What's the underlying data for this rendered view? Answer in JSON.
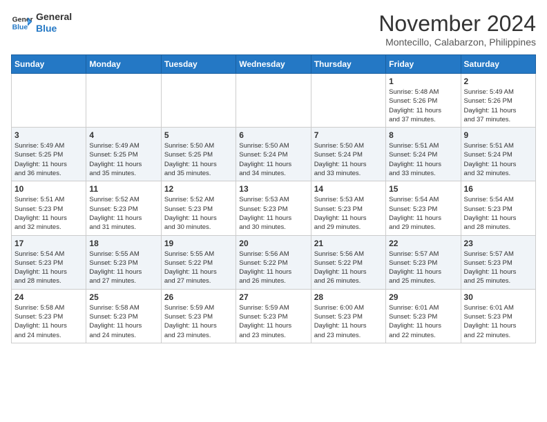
{
  "header": {
    "logo_line1": "General",
    "logo_line2": "Blue",
    "month_title": "November 2024",
    "location": "Montecillo, Calabarzon, Philippines"
  },
  "weekdays": [
    "Sunday",
    "Monday",
    "Tuesday",
    "Wednesday",
    "Thursday",
    "Friday",
    "Saturday"
  ],
  "weeks": [
    [
      {
        "day": "",
        "info": ""
      },
      {
        "day": "",
        "info": ""
      },
      {
        "day": "",
        "info": ""
      },
      {
        "day": "",
        "info": ""
      },
      {
        "day": "",
        "info": ""
      },
      {
        "day": "1",
        "info": "Sunrise: 5:48 AM\nSunset: 5:26 PM\nDaylight: 11 hours\nand 37 minutes."
      },
      {
        "day": "2",
        "info": "Sunrise: 5:49 AM\nSunset: 5:26 PM\nDaylight: 11 hours\nand 37 minutes."
      }
    ],
    [
      {
        "day": "3",
        "info": "Sunrise: 5:49 AM\nSunset: 5:25 PM\nDaylight: 11 hours\nand 36 minutes."
      },
      {
        "day": "4",
        "info": "Sunrise: 5:49 AM\nSunset: 5:25 PM\nDaylight: 11 hours\nand 35 minutes."
      },
      {
        "day": "5",
        "info": "Sunrise: 5:50 AM\nSunset: 5:25 PM\nDaylight: 11 hours\nand 35 minutes."
      },
      {
        "day": "6",
        "info": "Sunrise: 5:50 AM\nSunset: 5:24 PM\nDaylight: 11 hours\nand 34 minutes."
      },
      {
        "day": "7",
        "info": "Sunrise: 5:50 AM\nSunset: 5:24 PM\nDaylight: 11 hours\nand 33 minutes."
      },
      {
        "day": "8",
        "info": "Sunrise: 5:51 AM\nSunset: 5:24 PM\nDaylight: 11 hours\nand 33 minutes."
      },
      {
        "day": "9",
        "info": "Sunrise: 5:51 AM\nSunset: 5:24 PM\nDaylight: 11 hours\nand 32 minutes."
      }
    ],
    [
      {
        "day": "10",
        "info": "Sunrise: 5:51 AM\nSunset: 5:23 PM\nDaylight: 11 hours\nand 32 minutes."
      },
      {
        "day": "11",
        "info": "Sunrise: 5:52 AM\nSunset: 5:23 PM\nDaylight: 11 hours\nand 31 minutes."
      },
      {
        "day": "12",
        "info": "Sunrise: 5:52 AM\nSunset: 5:23 PM\nDaylight: 11 hours\nand 30 minutes."
      },
      {
        "day": "13",
        "info": "Sunrise: 5:53 AM\nSunset: 5:23 PM\nDaylight: 11 hours\nand 30 minutes."
      },
      {
        "day": "14",
        "info": "Sunrise: 5:53 AM\nSunset: 5:23 PM\nDaylight: 11 hours\nand 29 minutes."
      },
      {
        "day": "15",
        "info": "Sunrise: 5:54 AM\nSunset: 5:23 PM\nDaylight: 11 hours\nand 29 minutes."
      },
      {
        "day": "16",
        "info": "Sunrise: 5:54 AM\nSunset: 5:23 PM\nDaylight: 11 hours\nand 28 minutes."
      }
    ],
    [
      {
        "day": "17",
        "info": "Sunrise: 5:54 AM\nSunset: 5:23 PM\nDaylight: 11 hours\nand 28 minutes."
      },
      {
        "day": "18",
        "info": "Sunrise: 5:55 AM\nSunset: 5:23 PM\nDaylight: 11 hours\nand 27 minutes."
      },
      {
        "day": "19",
        "info": "Sunrise: 5:55 AM\nSunset: 5:22 PM\nDaylight: 11 hours\nand 27 minutes."
      },
      {
        "day": "20",
        "info": "Sunrise: 5:56 AM\nSunset: 5:22 PM\nDaylight: 11 hours\nand 26 minutes."
      },
      {
        "day": "21",
        "info": "Sunrise: 5:56 AM\nSunset: 5:22 PM\nDaylight: 11 hours\nand 26 minutes."
      },
      {
        "day": "22",
        "info": "Sunrise: 5:57 AM\nSunset: 5:23 PM\nDaylight: 11 hours\nand 25 minutes."
      },
      {
        "day": "23",
        "info": "Sunrise: 5:57 AM\nSunset: 5:23 PM\nDaylight: 11 hours\nand 25 minutes."
      }
    ],
    [
      {
        "day": "24",
        "info": "Sunrise: 5:58 AM\nSunset: 5:23 PM\nDaylight: 11 hours\nand 24 minutes."
      },
      {
        "day": "25",
        "info": "Sunrise: 5:58 AM\nSunset: 5:23 PM\nDaylight: 11 hours\nand 24 minutes."
      },
      {
        "day": "26",
        "info": "Sunrise: 5:59 AM\nSunset: 5:23 PM\nDaylight: 11 hours\nand 23 minutes."
      },
      {
        "day": "27",
        "info": "Sunrise: 5:59 AM\nSunset: 5:23 PM\nDaylight: 11 hours\nand 23 minutes."
      },
      {
        "day": "28",
        "info": "Sunrise: 6:00 AM\nSunset: 5:23 PM\nDaylight: 11 hours\nand 23 minutes."
      },
      {
        "day": "29",
        "info": "Sunrise: 6:01 AM\nSunset: 5:23 PM\nDaylight: 11 hours\nand 22 minutes."
      },
      {
        "day": "30",
        "info": "Sunrise: 6:01 AM\nSunset: 5:23 PM\nDaylight: 11 hours\nand 22 minutes."
      }
    ]
  ]
}
